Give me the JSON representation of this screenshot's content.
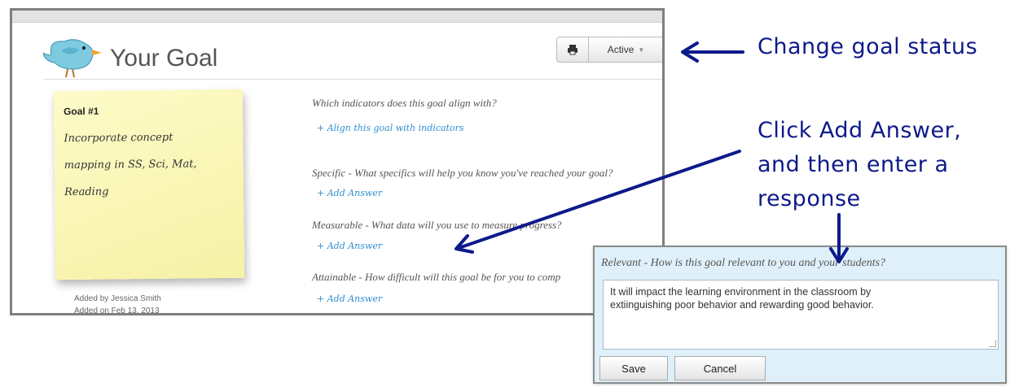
{
  "header": {
    "title": "Your Goal",
    "print_icon": "printer-icon",
    "status_value": "Active"
  },
  "goal": {
    "label": "Goal #1",
    "text_lines": [
      "Incorporate concept",
      "mapping in SS, Sci, Mat,",
      "Reading"
    ],
    "added_by": "Added by Jessica Smith",
    "added_on": "Added on Feb 13, 2013"
  },
  "questions": [
    {
      "prompt": "Which indicators does this goal align with?",
      "link": "+ Align this goal with indicators"
    },
    {
      "prompt": "Specific - What specifics will help you know you've reached your goal?",
      "link": "+ Add Answer"
    },
    {
      "prompt": "Measurable - What data will you use to measure progress?",
      "link": "+ Add Answer"
    },
    {
      "prompt": "Attainable - How difficult will this goal be for you to comp",
      "link": "+ Add Answer"
    }
  ],
  "annotations": {
    "status": "Change goal status",
    "add_answer_lines": [
      "Click Add Answer,",
      "and then enter a",
      "response"
    ]
  },
  "popup": {
    "prompt": "Relevant - How is this goal relevant to you and your students?",
    "answer_lines": [
      "It will impact the learning environment in the classroom by",
      "extiinguishing poor behavior and rewarding good behavior."
    ],
    "save_label": "Save",
    "cancel_label": "Cancel"
  },
  "colors": {
    "annotation": "#0d1a8a",
    "link": "#2f8fd0",
    "note": "#f8f4b0",
    "popup_bg": "#dff0fa"
  }
}
